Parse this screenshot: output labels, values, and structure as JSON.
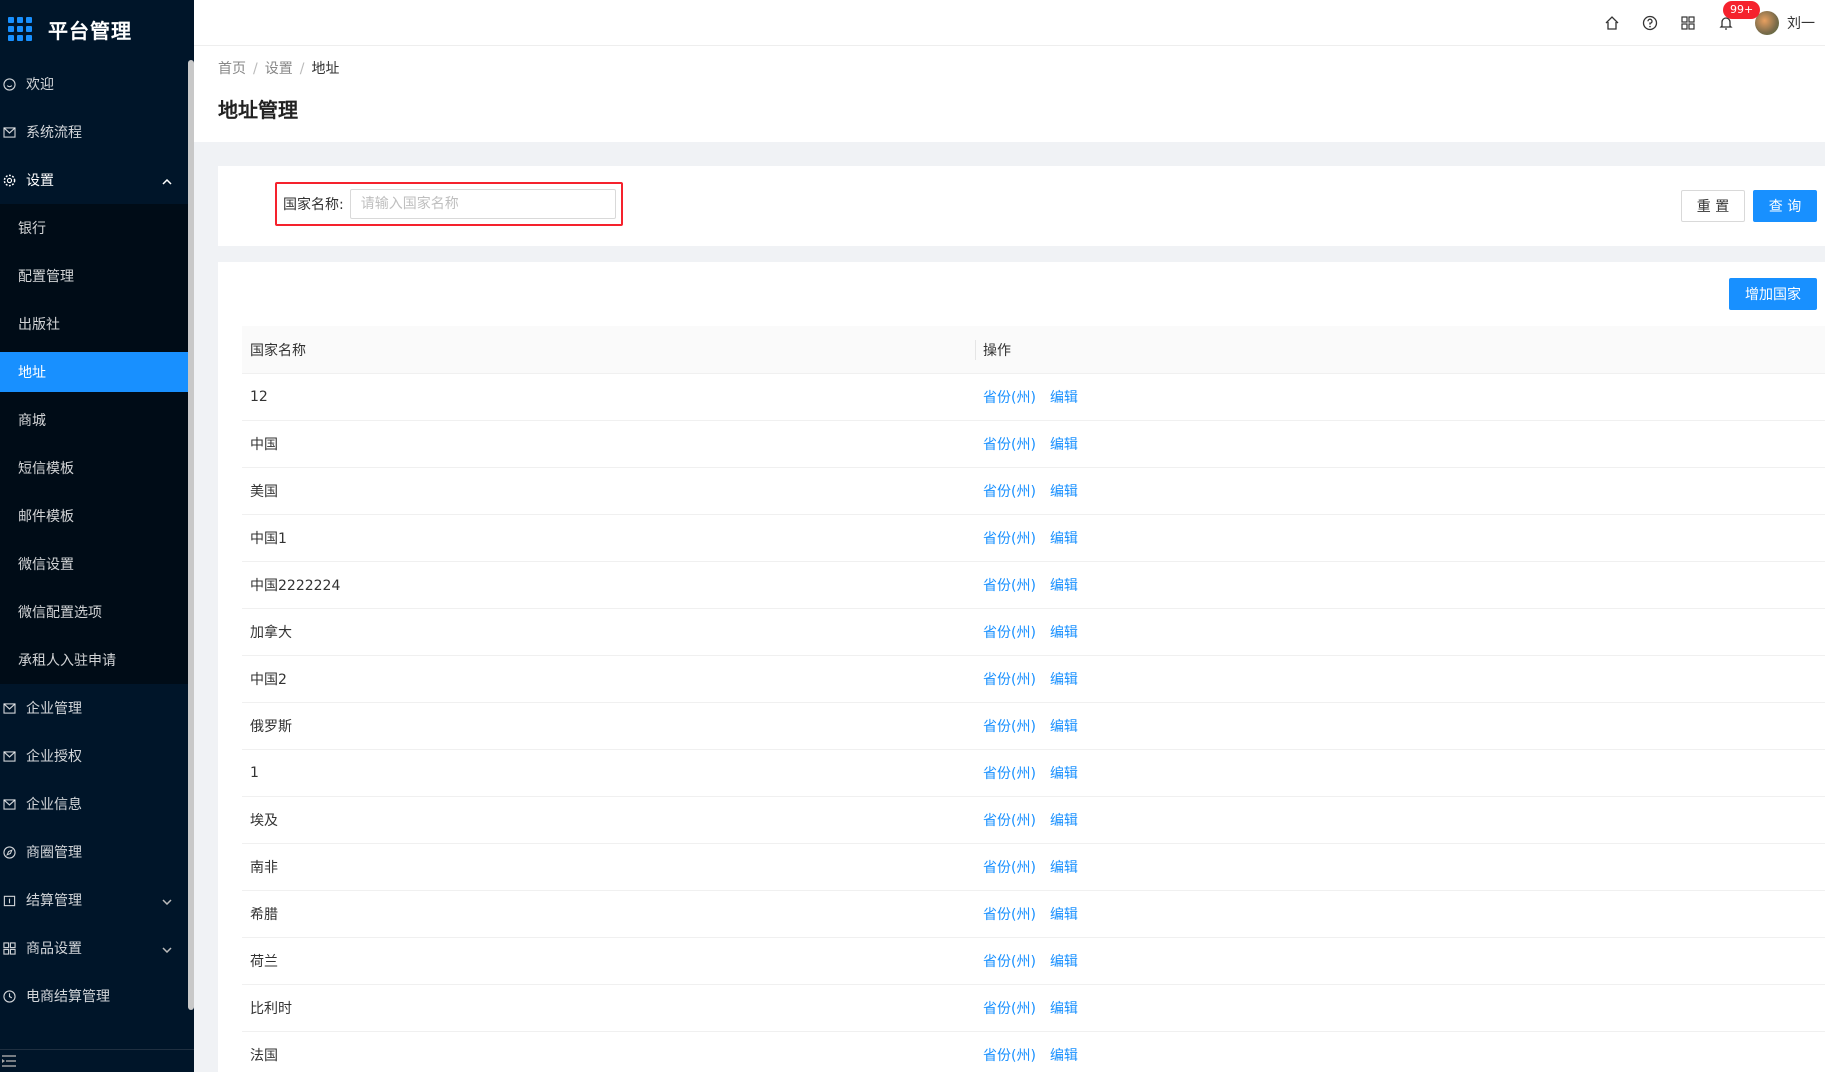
{
  "app": {
    "title": "平台管理"
  },
  "sidebar": {
    "items": [
      {
        "label": "欢迎",
        "icon": "smile-icon"
      },
      {
        "label": "系统流程",
        "icon": "mail-icon"
      },
      {
        "label": "设置",
        "icon": "gear-icon",
        "open": true,
        "children": [
          {
            "label": "银行"
          },
          {
            "label": "配置管理"
          },
          {
            "label": "出版社"
          },
          {
            "label": "地址",
            "active": true
          },
          {
            "label": "商城"
          },
          {
            "label": "短信模板"
          },
          {
            "label": "邮件模板"
          },
          {
            "label": "微信设置"
          },
          {
            "label": "微信配置选项"
          },
          {
            "label": "承租人入驻申请"
          }
        ]
      },
      {
        "label": "企业管理",
        "icon": "mail-icon"
      },
      {
        "label": "企业授权",
        "icon": "mail-icon"
      },
      {
        "label": "企业信息",
        "icon": "mail-icon"
      },
      {
        "label": "商圈管理",
        "icon": "compass-icon"
      },
      {
        "label": "结算管理",
        "icon": "calendar-icon",
        "arrow": true
      },
      {
        "label": "商品设置",
        "icon": "appstore-icon",
        "arrow": true
      },
      {
        "label": "电商结算管理",
        "icon": "clock-icon"
      }
    ]
  },
  "header": {
    "notification_count": "99+",
    "user_name": "刘一"
  },
  "breadcrumb": [
    "首页",
    "设置",
    "地址"
  ],
  "page_title": "地址管理",
  "search": {
    "label": "国家名称:",
    "placeholder": "请输入国家名称",
    "reset_label": "重 置",
    "query_label": "查 询"
  },
  "table": {
    "add_button_label": "增加国家",
    "columns": [
      "国家名称",
      "操作"
    ],
    "action_provinces": "省份(州)",
    "action_edit": "编辑",
    "rows": [
      "12",
      "中国",
      "美国",
      "中国1",
      "中国2222224",
      "加拿大",
      "中国2",
      "俄罗斯",
      "1",
      "埃及",
      "南非",
      "希腊",
      "荷兰",
      "比利时",
      "法国"
    ]
  },
  "colors": {
    "accent": "#1890ff",
    "sidebar_bg": "#001529",
    "highlight_border": "#f5222d"
  }
}
